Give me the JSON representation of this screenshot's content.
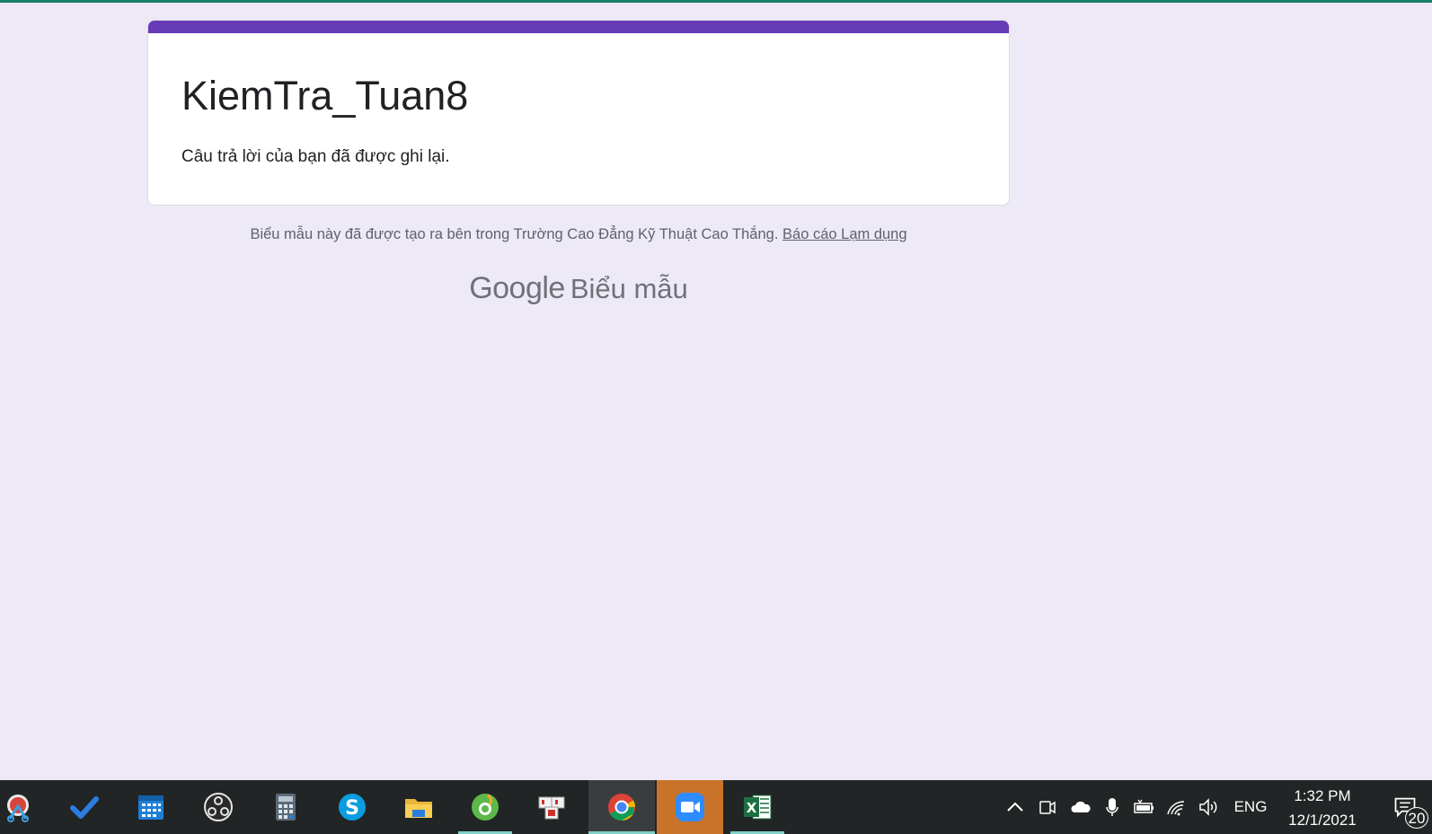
{
  "page": {
    "background": "#ede9f7",
    "accent": "#673ab7"
  },
  "form": {
    "title": "KiemTra_Tuan8",
    "message": "Câu trả lời của bạn đã được ghi lại."
  },
  "footer": {
    "note": "Biểu mẫu này đã được tạo ra bên trong Trường Cao Đẳng Kỹ Thuật Cao Thắng. ",
    "report_link": "Báo cáo Lạm dụng"
  },
  "brand": {
    "google": "Google",
    "product": "Biểu mẫu"
  },
  "taskbar": {
    "apps": [
      {
        "name": "snipping-tool-icon"
      },
      {
        "name": "todo-icon"
      },
      {
        "name": "calendar-icon"
      },
      {
        "name": "obs-icon"
      },
      {
        "name": "calculator-icon"
      },
      {
        "name": "skype-icon"
      },
      {
        "name": "file-explorer-icon"
      },
      {
        "name": "coccoc-icon"
      },
      {
        "name": "unikey-icon"
      },
      {
        "name": "chrome-icon"
      },
      {
        "name": "zoom-icon"
      },
      {
        "name": "excel-icon"
      }
    ],
    "tray": {
      "language": "ENG",
      "time": "1:32 PM",
      "date": "12/1/2021",
      "notification_count": "20"
    }
  }
}
